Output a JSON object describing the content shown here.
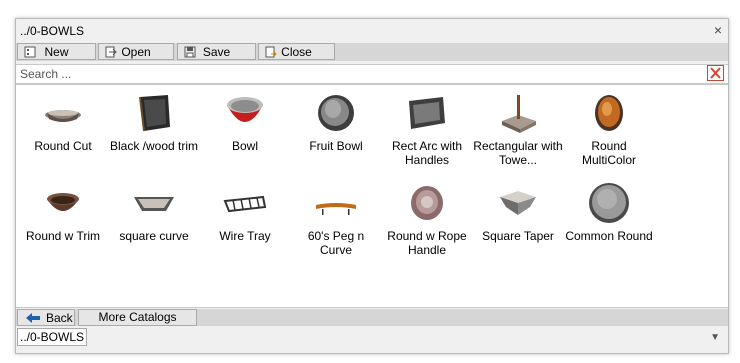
{
  "window": {
    "title": "../0-BOWLS",
    "close_glyph": "×"
  },
  "toolbar": {
    "buttons": [
      {
        "label": "New",
        "icon": "new-catalog-icon"
      },
      {
        "label": "Open",
        "icon": "open-catalog-icon"
      },
      {
        "label": "Save",
        "icon": "save-icon"
      },
      {
        "label": "Close",
        "icon": "close-catalog-icon"
      }
    ]
  },
  "search": {
    "placeholder": "Search ...",
    "value": "",
    "clear_icon": "clear-search-icon",
    "clear_color": "#d9432b"
  },
  "items": [
    {
      "label": "Round Cut"
    },
    {
      "label": "Black /wood trim"
    },
    {
      "label": "Bowl"
    },
    {
      "label": "Fruit Bowl"
    },
    {
      "label": "Rect Arc with Handles"
    },
    {
      "label": "Rectangular with Towe..."
    },
    {
      "label": "Round MultiColor"
    },
    {
      "label": "Round w Trim"
    },
    {
      "label": "square curve"
    },
    {
      "label": "Wire Tray"
    },
    {
      "label": "60's Peg n Curve"
    },
    {
      "label": "Round w Rope Handle"
    },
    {
      "label": "Square Taper"
    },
    {
      "label": "Common Round"
    }
  ],
  "bottom": {
    "back_label": "Back",
    "back_icon": "back-arrow-icon",
    "more_label": "More Catalogs",
    "tab_label": "../0-BOWLS",
    "dropdown_icon": "chevron-down-icon"
  }
}
